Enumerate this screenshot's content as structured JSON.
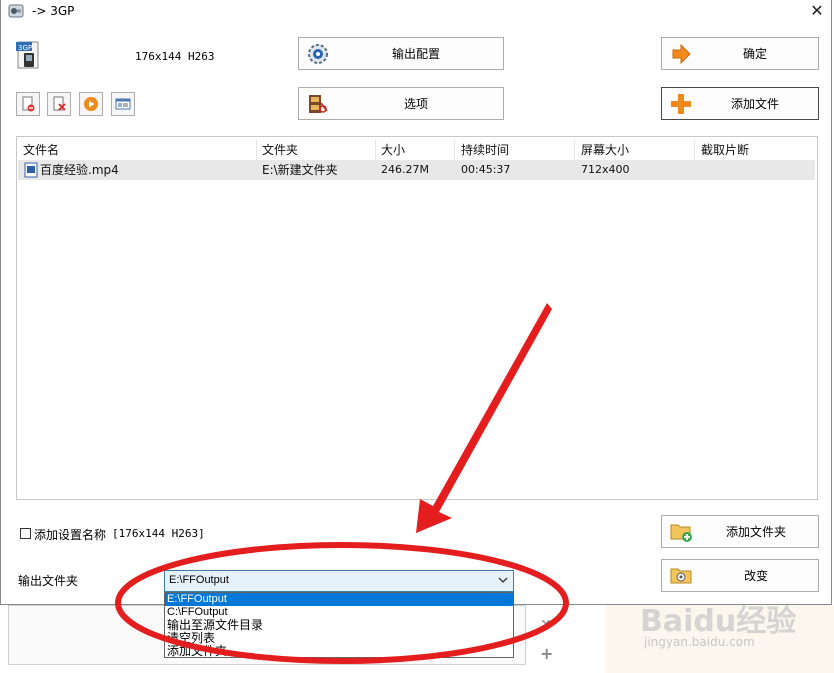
{
  "window": {
    "title": "-> 3GP"
  },
  "format": {
    "spec": "176x144 H263"
  },
  "buttons": {
    "output_config": "输出配置",
    "options": "选项",
    "ok": "确定",
    "add_file": "添加文件",
    "add_folder": "添加文件夹",
    "change": "改变"
  },
  "table": {
    "headers": [
      "文件名",
      "文件夹",
      "大小",
      "持续时间",
      "屏幕大小",
      "截取片断"
    ],
    "rows": [
      {
        "name": "百度经验.mp4",
        "folder": "E:\\新建文件夹",
        "size": "246.27M",
        "duration": "00:45:37",
        "screen": "712x400",
        "clip": ""
      }
    ]
  },
  "settings": {
    "add_name_label": "添加设置名称",
    "add_name_spec": "[176x144 H263]",
    "checked": false
  },
  "output": {
    "label": "输出文件夹",
    "selected": "E:\\FFOutput",
    "options": [
      "E:\\FFOutput",
      "C:\\FFOutput",
      "输出至源文件目录",
      "清空列表",
      "添加文件夹..."
    ]
  },
  "watermark": {
    "text": "Baidu经验",
    "sub": "jingyan.baidu.com"
  },
  "colors": {
    "annotation_red": "#e41e1e",
    "selection_blue": "#0078d7",
    "accent_orange": "#f28a1b"
  }
}
